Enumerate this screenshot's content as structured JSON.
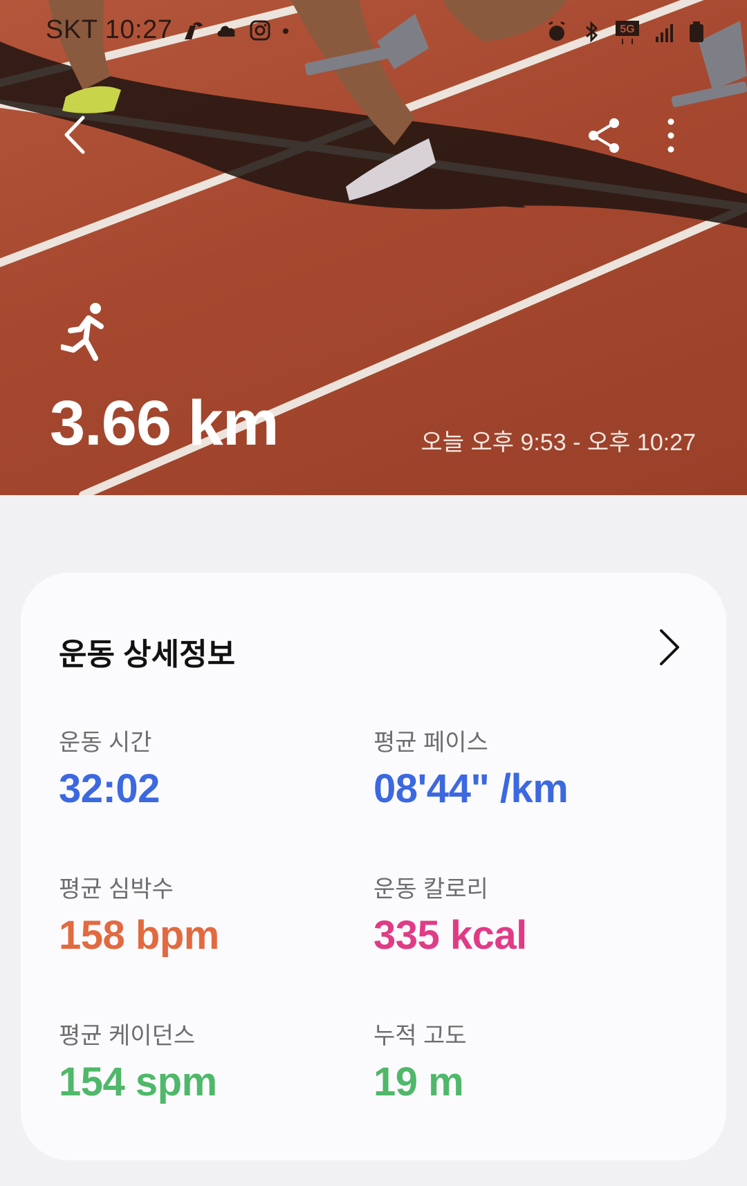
{
  "status_bar": {
    "carrier_time": "SKT 10:27",
    "network": "5G"
  },
  "workout": {
    "distance": "3.66 km",
    "time_range": "오늘 오후 9:53 - 오후 10:27"
  },
  "details": {
    "title": "운동 상세정보",
    "metrics": [
      {
        "label": "운동 시간",
        "value": "32:02",
        "color": "#3c68e0"
      },
      {
        "label": "평균 페이스",
        "value": "08'44\" /km",
        "color": "#3c68e0"
      },
      {
        "label": "평균 심박수",
        "value": "158 bpm",
        "color": "#e26a40"
      },
      {
        "label": "운동 칼로리",
        "value": "335 kcal",
        "color": "#e03c86"
      },
      {
        "label": "평균 케이던스",
        "value": "154 spm",
        "color": "#4fb86a"
      },
      {
        "label": "누적 고도",
        "value": "19 m",
        "color": "#4fb86a"
      }
    ]
  },
  "icons": [
    "back-icon",
    "share-icon",
    "more-icon",
    "running-icon",
    "chevron-right-icon"
  ]
}
